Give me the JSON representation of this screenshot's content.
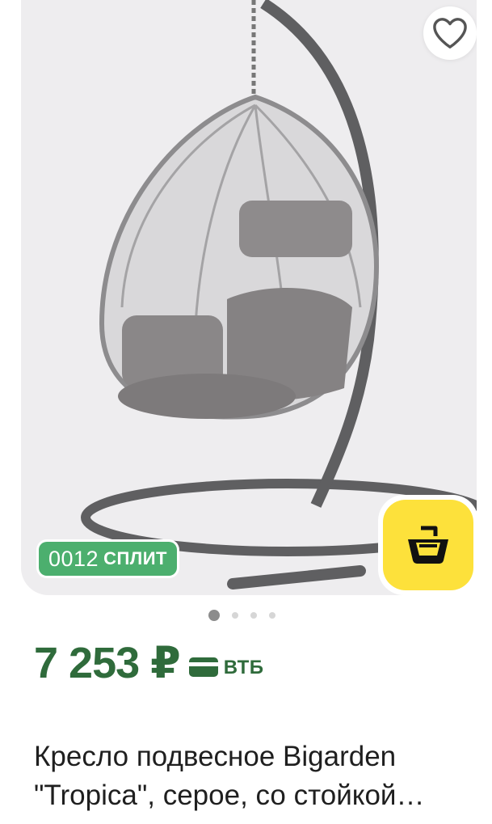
{
  "product": {
    "image_description_icon": "hanging-egg-chair-photo",
    "gallery": {
      "total_slides": 4,
      "active_slide": 1
    },
    "favorite_icon": "heart-outline-icon",
    "split": {
      "amount": "0012",
      "label": "СПЛИТ"
    },
    "cart_icon": "basket-icon",
    "price": "7 253 ₽",
    "payment_icon": "card-icon",
    "bank": "ВТБ",
    "title_line1": "Кресло подвесное Bigarden",
    "title_line2": "\"Tropica\", серое, со стойкой…"
  },
  "colors": {
    "price_green": "#2f6b3b",
    "split_green": "#4caf6e",
    "cart_yellow": "#fde13b",
    "image_bg": "#eeedef"
  }
}
